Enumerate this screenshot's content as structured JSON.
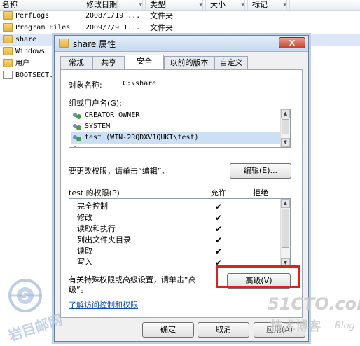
{
  "explorer": {
    "columns": [
      "名称",
      "修改日期",
      "类型",
      "大小",
      "标记"
    ],
    "files": [
      {
        "name": "PerfLogs",
        "date": "2008/1/19 ...",
        "type": "文件夹",
        "kind": "folder"
      },
      {
        "name": "Program Files",
        "date": "2009/7/9 1...",
        "type": "文件夹",
        "kind": "folder"
      },
      {
        "name": "share",
        "date": "",
        "type": "",
        "kind": "folder"
      },
      {
        "name": "Windows",
        "date": "",
        "type": "",
        "kind": "folder"
      },
      {
        "name": "用户",
        "date": "",
        "type": "",
        "kind": "folder"
      },
      {
        "name": "BOOTSECT.",
        "date": "",
        "type": "",
        "kind": "file"
      }
    ]
  },
  "dialog": {
    "title": "share 属性",
    "close_label": "X",
    "tabs": [
      "常规",
      "共享",
      "安全",
      "以前的版本",
      "自定义"
    ],
    "active_tab": "安全",
    "object_label": "对象名称:",
    "object_value": "C:\\share",
    "group_label": "组或用户名(G):",
    "users": [
      "CREATOR OWNER",
      "SYSTEM",
      "test (WIN-2RQDXV1QUKI\\test)",
      "..."
    ],
    "selected_user_index": 2,
    "change_hint": "要更改权限，请单击“编辑”。",
    "edit_button": "编辑(E)...",
    "perm_label": "test 的权限(P)",
    "allow_label": "允许",
    "deny_label": "拒绝",
    "permissions": [
      {
        "name": "完全控制",
        "allow": "✔"
      },
      {
        "name": "修改",
        "allow": "✔"
      },
      {
        "name": "读取和执行",
        "allow": "✔"
      },
      {
        "name": "列出文件夹目录",
        "allow": "✔"
      },
      {
        "name": "读取",
        "allow": "✔"
      },
      {
        "name": "写入",
        "allow": "✔"
      }
    ],
    "advanced_hint_1": "有关特殊权限或高级设置，请单击“高",
    "advanced_hint_2": "级”。",
    "advanced_button": "高级(V)",
    "learn_link": "了解访问控制和权限",
    "ok_button": "确定",
    "cancel_button": "取消",
    "apply_button": "应用(A)"
  },
  "watermark": {
    "right_logo": "51CTO.com",
    "right_sub": "技术博客",
    "right_blog": "Blog",
    "left_text": "岩目邮网"
  },
  "colors": {
    "highlight": "#e0201c",
    "link": "#0b4fb5",
    "selection": "#cce0f5"
  }
}
